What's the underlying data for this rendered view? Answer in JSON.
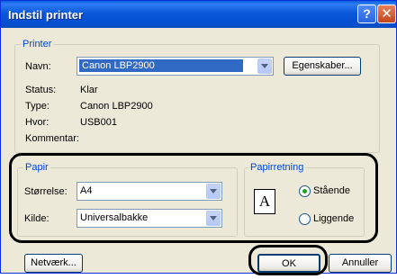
{
  "window": {
    "title": "Indstil printer"
  },
  "printer": {
    "legend": "Printer",
    "name_label": "Navn:",
    "name_value": "Canon LBP2900",
    "properties_button": "Egenskaber...",
    "status_label": "Status:",
    "status_value": "Klar",
    "type_label": "Type:",
    "type_value": "Canon LBP2900",
    "where_label": "Hvor:",
    "where_value": "USB001",
    "comment_label": "Kommentar:"
  },
  "paper": {
    "legend": "Papir",
    "size_label": "Størrelse:",
    "size_value": "A4",
    "source_label": "Kilde:",
    "source_value": "Universalbakke"
  },
  "orientation": {
    "legend": "Papirretning",
    "portrait_icon_letter": "A",
    "portrait_label": "Stående",
    "landscape_label": "Liggende",
    "selected": "Stående"
  },
  "buttons": {
    "network": "Netværk...",
    "ok": "OK",
    "cancel": "Annuller"
  },
  "colors": {
    "title_bar": "#0a58d8",
    "face": "#ece9d8",
    "legend": "#0046d5",
    "selection": "#316ac5"
  }
}
